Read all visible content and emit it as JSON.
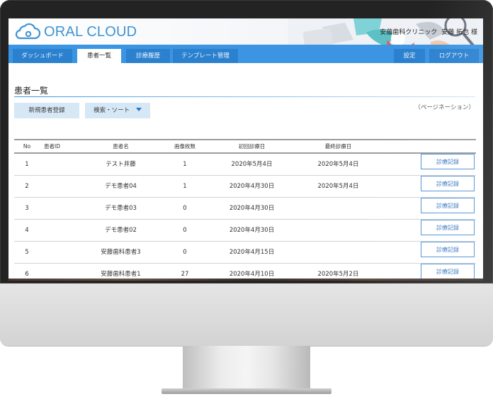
{
  "app": {
    "logo_text": "ORAL CLOUD",
    "clinic_name": "安藤歯科クリニック",
    "user_name": "安藤 拓也 様"
  },
  "nav": {
    "tabs": [
      {
        "label": "ダッシュボード"
      },
      {
        "label": "患者一覧"
      },
      {
        "label": "診療履歴"
      },
      {
        "label": "テンプレート管理"
      }
    ],
    "settings_label": "設定",
    "logout_label": "ログアウト"
  },
  "page": {
    "title": "患者一覧",
    "new_patient_label": "新規患者登録",
    "search_sort_label": "検索・ソート",
    "pagination_label": "（ページネーション）"
  },
  "table": {
    "columns": [
      "No",
      "患者ID",
      "患者名",
      "画像枚数",
      "初回診療日",
      "最終診療日"
    ],
    "record_button_label": "診療記録",
    "rows": [
      {
        "no": "1",
        "id": "",
        "name": "テスト井藤",
        "images": "1",
        "first": "2020年5月4日",
        "last": "2020年5月4日"
      },
      {
        "no": "2",
        "id": "",
        "name": "デモ患者04",
        "images": "1",
        "first": "2020年4月30日",
        "last": "2020年5月4日"
      },
      {
        "no": "3",
        "id": "",
        "name": "デモ患者03",
        "images": "0",
        "first": "2020年4月30日",
        "last": ""
      },
      {
        "no": "4",
        "id": "",
        "name": "デモ患者02",
        "images": "0",
        "first": "2020年4月30日",
        "last": ""
      },
      {
        "no": "5",
        "id": "",
        "name": "安藤歯科患者3",
        "images": "0",
        "first": "2020年4月15日",
        "last": ""
      },
      {
        "no": "6",
        "id": "",
        "name": "安藤歯科患者1",
        "images": "27",
        "first": "2020年4月10日",
        "last": "2020年5月2日"
      }
    ]
  },
  "colors": {
    "accent": "#3b95e2",
    "tab_bg": "#2c81cf",
    "button_light": "#d6e7f6",
    "bezel": "#232323"
  },
  "icons": [
    "cloud-logo-icon",
    "dropdown-triangle-icon"
  ]
}
